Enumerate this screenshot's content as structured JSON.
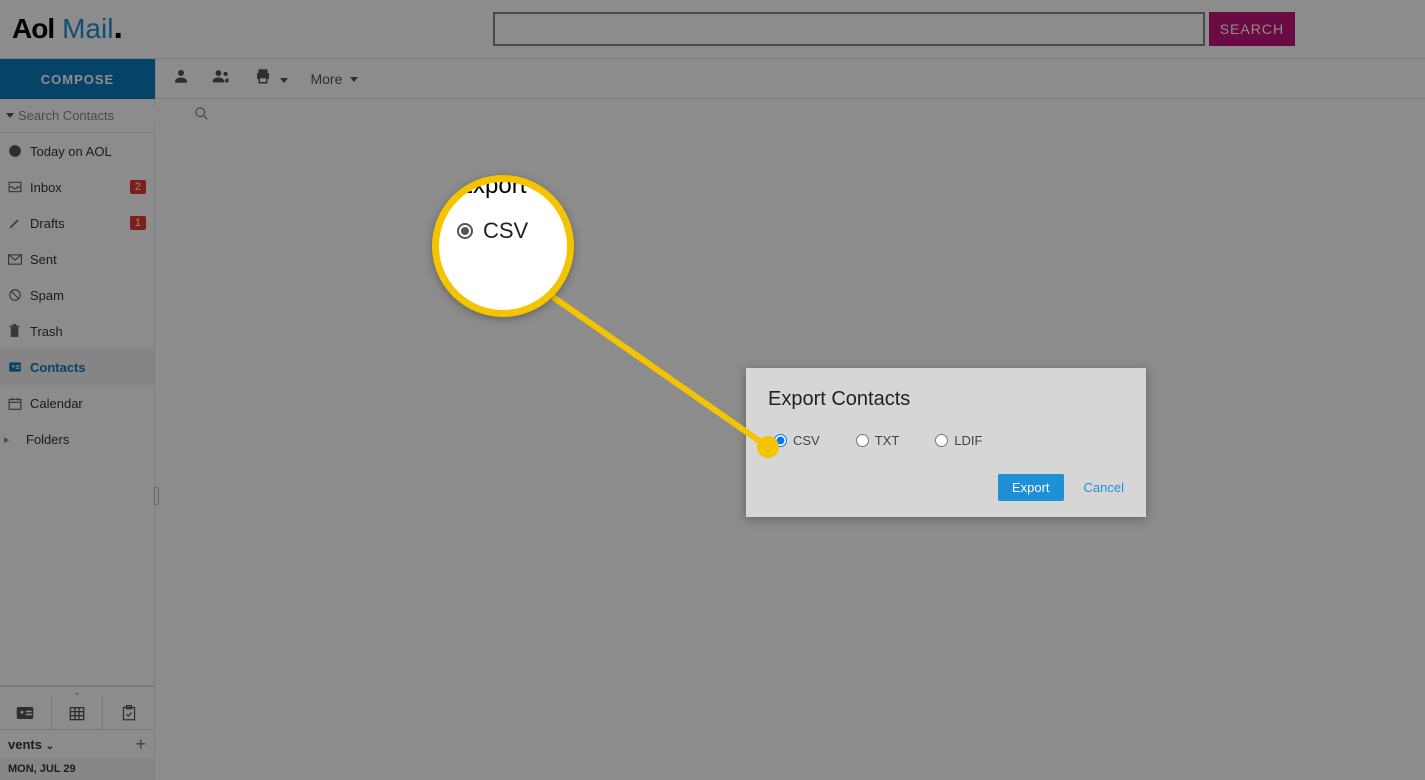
{
  "header": {
    "logo_aol": "Aol",
    "logo_mail": "Mail",
    "search_placeholder": "",
    "search_button": "SEARCH"
  },
  "toolbar": {
    "compose": "COMPOSE",
    "more": "More"
  },
  "sidebar": {
    "search_placeholder": "Search Contacts",
    "items": [
      {
        "label": "Today on AOL"
      },
      {
        "label": "Inbox",
        "badge": "2"
      },
      {
        "label": "Drafts",
        "badge": "1"
      },
      {
        "label": "Sent"
      },
      {
        "label": "Spam"
      },
      {
        "label": "Trash"
      },
      {
        "label": "Contacts",
        "selected": true
      },
      {
        "label": "Calendar"
      },
      {
        "label": "Folders"
      }
    ],
    "events_label": "vents",
    "date_label": "MON, JUL 29"
  },
  "dialog": {
    "title": "Export Contacts",
    "options": {
      "csv": "CSV",
      "txt": "TXT",
      "ldif": "LDIF"
    },
    "selected": "csv",
    "export_button": "Export",
    "cancel_button": "Cancel"
  },
  "callout": {
    "title": "Export",
    "label": "CSV"
  },
  "colors": {
    "accent_blue": "#1e90d6",
    "compose_blue": "#0a7ac0",
    "search_magenta": "#c4147b",
    "badge_red": "#e53935",
    "callout_yellow": "#f5c400"
  }
}
